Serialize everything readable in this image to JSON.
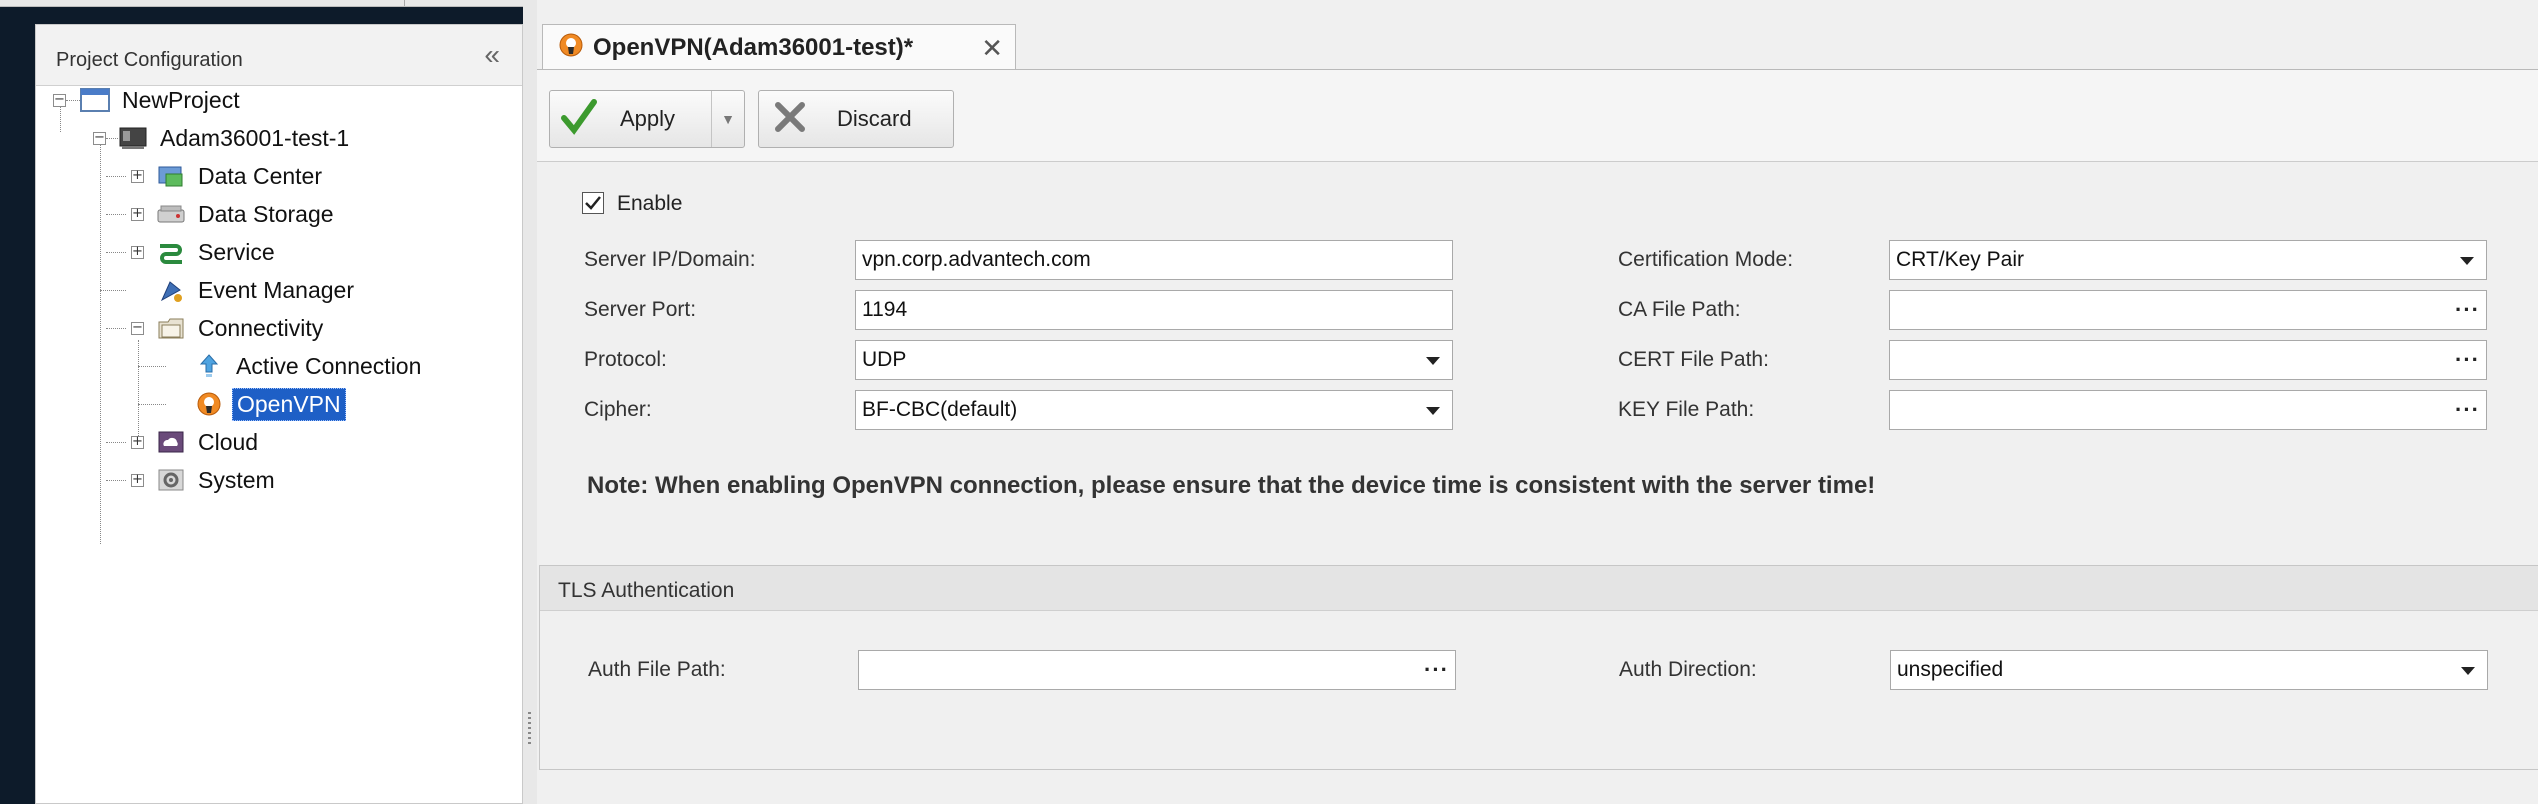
{
  "project_panel": {
    "title": "Project Configuration",
    "collapse_glyph": "«",
    "tree": {
      "root": "NewProject",
      "device": "Adam36001-test-1",
      "items": [
        "Data Center",
        "Data Storage",
        "Service",
        "Event Manager",
        "Connectivity",
        "Cloud",
        "System"
      ],
      "connectivity_children": [
        "Active Connection",
        "OpenVPN"
      ],
      "selected": "OpenVPN"
    }
  },
  "document_tab": {
    "title": "OpenVPN(Adam36001-test)*",
    "close_glyph": "✕"
  },
  "toolbar": {
    "apply_label": "Apply",
    "discard_label": "Discard"
  },
  "form": {
    "enable_label": "Enable",
    "enable_checked": true,
    "server_ip_label": "Server IP/Domain:",
    "server_ip_value": "vpn.corp.advantech.com",
    "server_port_label": "Server Port:",
    "server_port_value": "1194",
    "protocol_label": "Protocol:",
    "protocol_value": "UDP",
    "cipher_label": "Cipher:",
    "cipher_value": "BF-CBC(default)",
    "cert_mode_label": "Certification Mode:",
    "cert_mode_value": "CRT/Key Pair",
    "ca_path_label": "CA File Path:",
    "cert_path_label": "CERT File Path:",
    "key_path_label": "KEY File Path:",
    "browse_glyph": "···",
    "note": "Note: When enabling OpenVPN connection, please ensure that the device time is consistent with the server time!"
  },
  "tls": {
    "title": "TLS Authentication",
    "auth_path_label": "Auth File Path:",
    "auth_direction_label": "Auth Direction:",
    "auth_direction_value": "unspecified"
  },
  "colors": {
    "selection": "#1e5fc6",
    "panel_bg": "#f0f0f0",
    "desktop": "#0d1b2a"
  }
}
